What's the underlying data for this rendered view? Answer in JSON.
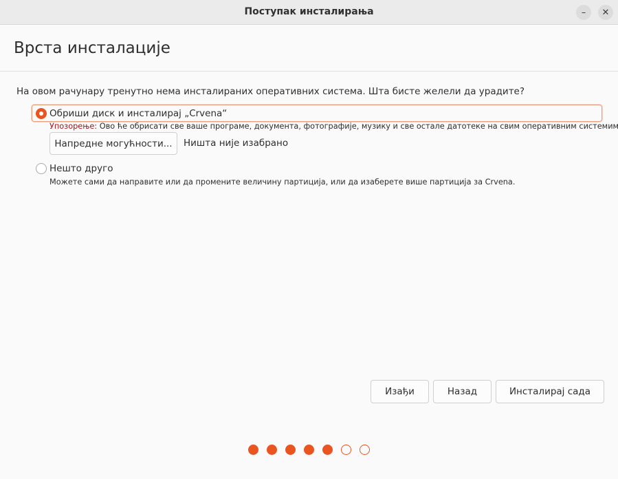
{
  "window": {
    "title": "Поступак инсталирања",
    "minimize_glyph": "–",
    "close_glyph": "✕"
  },
  "page": {
    "title": "Врста инсталације",
    "question": "На овом рачунару тренутно нема инсталираних оперативних система. Шта бисте желели да урадите?"
  },
  "options": [
    {
      "label": "Обриши диск и инсталирај „Crvena“",
      "selected": true,
      "warning_prefix": "Упозорење:",
      "warning_text": " Ово ће обрисати све ваше програме, документа, фотографије, музику и све остале датотеке на свим оперативним системима.",
      "advanced_button": "Напредне могућности...",
      "advanced_status": "Ништа није изабрано"
    },
    {
      "label": "Нешто друго",
      "selected": false,
      "description": "Можете сами да направите или да промените величину партиција, или да изаберете више партиција за Crvena."
    }
  ],
  "buttons": {
    "quit": "Изађи",
    "back": "Назад",
    "install": "Инсталирај сада"
  },
  "progress": {
    "total_steps": 7,
    "completed_steps": 5
  },
  "colors": {
    "accent": "#e95420",
    "warning": "#a5141a"
  }
}
